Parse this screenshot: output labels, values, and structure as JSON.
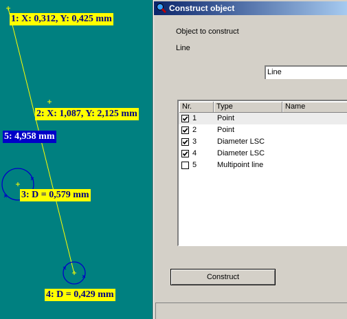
{
  "canvas": {
    "labels": [
      {
        "text": "1: X: 0,312, Y: 0,425 mm"
      },
      {
        "text": "2: X: 1,087, Y: 2,125 mm"
      },
      {
        "text": "5: 4,958 mm",
        "selected": true
      },
      {
        "text": "3: D = 0,579  mm"
      },
      {
        "text": "4: D = 0,429  mm"
      }
    ],
    "colors": {
      "background": "#008080",
      "label_bg": "#ffff00",
      "label_text": "#000080",
      "selected_bg": "#0000c8",
      "line": "#ffff00",
      "circle": "#0000c8"
    }
  },
  "dialog": {
    "title": "Construct object",
    "icon": "magnifier-icon",
    "object_label": "Object to construct",
    "object_type": "Line",
    "combo_value": "Line",
    "table": {
      "columns": [
        "Nr.",
        "Type",
        "Name"
      ],
      "rows": [
        {
          "nr": "1",
          "type": "Point",
          "checked": true
        },
        {
          "nr": "2",
          "type": "Point",
          "checked": true
        },
        {
          "nr": "3",
          "type": "Diameter LSC",
          "checked": true
        },
        {
          "nr": "4",
          "type": "Diameter LSC",
          "checked": true
        },
        {
          "nr": "5",
          "type": "Multipoint line",
          "checked": false
        }
      ]
    },
    "construct_button": "Construct"
  }
}
